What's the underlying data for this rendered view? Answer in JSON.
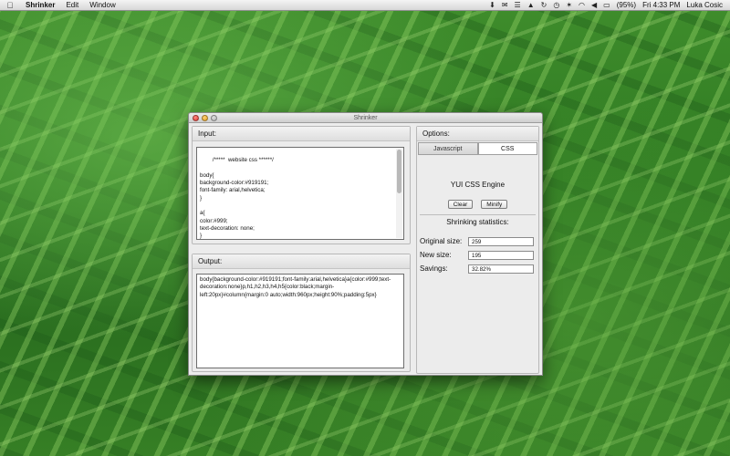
{
  "menubar": {
    "apple_icon": "apple-icon",
    "app_name": "Shrinker",
    "menus": [
      "Edit",
      "Window"
    ],
    "status": {
      "battery": "(95%)",
      "clock": "Fri 4:33 PM",
      "user": "Luka Cosic",
      "icons": [
        "download-icon",
        "mail-icon",
        "chart-icon",
        "adobe-icon",
        "sync-icon",
        "time-machine-icon",
        "bluetooth-icon",
        "wifi-icon",
        "volume-icon",
        "battery-icon"
      ]
    }
  },
  "window": {
    "title": "Shrinker",
    "input": {
      "header": "Input:",
      "text": "/*****  website css ******/\n\nbody{\nbackground-color:#919191;\nfont-family: arial,helvetica;\n}\n\na{\ncolor:#999;\ntext-decoration: none;\n}"
    },
    "output": {
      "header": "Output:",
      "text": "body{background-color:#919191;font-family:arial,helvetica}a{color:#999;text-decoration:none}p,h1,h2,h3,h4,h5{color:black;margin-left:20px}#column{margin:0 auto;width:960px;height:90%;padding:5px}"
    },
    "options": {
      "header": "Options:",
      "tabs": [
        "Javascript",
        "CSS"
      ],
      "active_tab": "CSS",
      "engine": "YUI CSS Engine",
      "clear_label": "Clear",
      "minify_label": "Minify",
      "stats_title": "Shrinking statistics:",
      "original_label": "Original size:",
      "original_value": "259",
      "new_label": "New size:",
      "new_value": "195",
      "savings_label": "Savings:",
      "savings_value": "32.82%"
    }
  }
}
